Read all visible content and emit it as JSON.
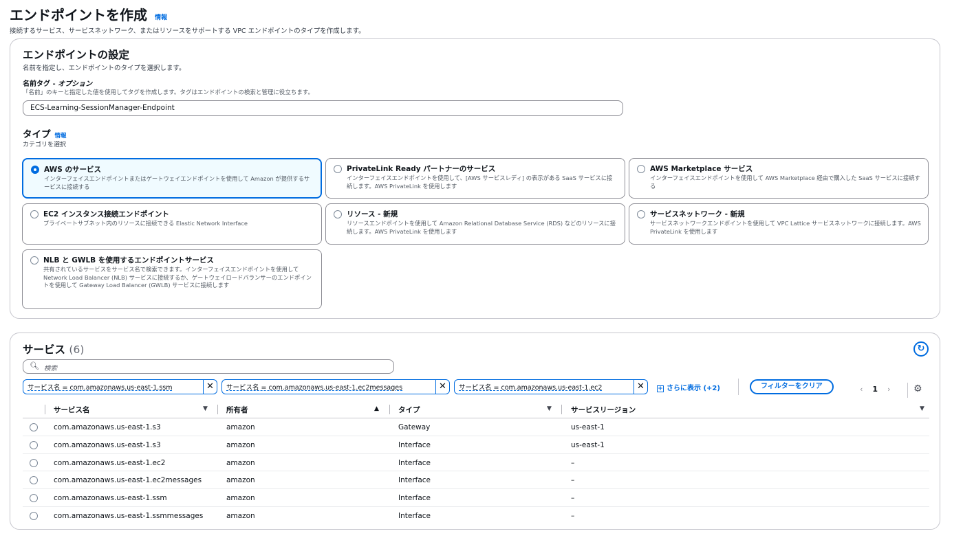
{
  "page": {
    "title": "エンドポイントを作成",
    "info": "情報",
    "description": "接続するサービス、サービスネットワーク、またはリソースをサポートする VPC エンドポイントのタイプを作成します。"
  },
  "settings": {
    "title": "エンドポイントの設定",
    "description": "名前を指定し、エンドポイントのタイプを選択します。",
    "name_label": "名前タグ - ",
    "name_label_optional": "オプション",
    "name_hint": "「名前」のキーと指定した値を使用してタグを作成します。タグはエンドポイントの検索と管理に役立ちます。",
    "name_value": "ECS-Learning-SessionManager-Endpoint",
    "type_title": "タイプ",
    "type_info": "情報",
    "type_desc": "カテゴリを選択",
    "tiles": [
      {
        "title": "AWS のサービス",
        "desc": "インターフェイスエンドポイントまたはゲートウェイエンドポイントを使用して Amazon が提供するサービスに接続する",
        "selected": true
      },
      {
        "title": "PrivateLink Ready パートナーのサービス",
        "desc": "インターフェイスエンドポイントを使用して、[AWS サービスレディ] の表示がある SaaS サービスに接続します。AWS PrivateLink を使用します",
        "selected": false
      },
      {
        "title": "AWS Marketplace サービス",
        "desc": "インターフェイスエンドポイントを使用して AWS Marketplace 経由で購入した SaaS サービスに接続する",
        "selected": false
      },
      {
        "title": "EC2 インスタンス接続エンドポイント",
        "desc": "プライベートサブネット内のリソースに接続できる Elastic Network Interface",
        "selected": false
      },
      {
        "title": "リソース - 新規",
        "desc": "リソースエンドポイントを使用して Amazon Relational Database Service (RDS) などのリソースに接続します。AWS PrivateLink を使用します",
        "selected": false
      },
      {
        "title": "サービスネットワーク - 新規",
        "desc": "サービスネットワークエンドポイントを使用して VPC Lattice サービスネットワークに接続します。AWS PrivateLink を使用します",
        "selected": false
      },
      {
        "title": "NLB と GWLB を使用するエンドポイントサービス",
        "desc": "共有されているサービスをサービス名で検索できます。インターフェイスエンドポイントを使用して Network Load Balancer (NLB) サービスに接続するか、ゲートウェイロードバランサーのエンドポイントを使用して Gateway Load Balancer (GWLB) サービスに接続します",
        "selected": false
      }
    ]
  },
  "services": {
    "title": "サービス",
    "count": "(6)",
    "search_placeholder": "検索",
    "tokens": [
      "サービス名 = com.amazonaws.us-east-1.ssm",
      "サービス名 = com.amazonaws.us-east-1.ec2messages",
      "サービス名 = com.amazonaws.us-east-1.ec2"
    ],
    "more": "さらに表示 (+2)",
    "clear": "フィルターをクリア",
    "page": "1",
    "columns": [
      "サービス名",
      "所有者",
      "タイプ",
      "サービスリージョン"
    ],
    "rows": [
      [
        "com.amazonaws.us-east-1.s3",
        "amazon",
        "Gateway",
        "us-east-1"
      ],
      [
        "com.amazonaws.us-east-1.s3",
        "amazon",
        "Interface",
        "us-east-1"
      ],
      [
        "com.amazonaws.us-east-1.ec2",
        "amazon",
        "Interface",
        "–"
      ],
      [
        "com.amazonaws.us-east-1.ec2messages",
        "amazon",
        "Interface",
        "–"
      ],
      [
        "com.amazonaws.us-east-1.ssm",
        "amazon",
        "Interface",
        "–"
      ],
      [
        "com.amazonaws.us-east-1.ssmmessages",
        "amazon",
        "Interface",
        "–"
      ]
    ]
  },
  "colors": {
    "accent": "#006ce0",
    "selected_bg": "#f0fbff",
    "border": "#8c8c94"
  }
}
